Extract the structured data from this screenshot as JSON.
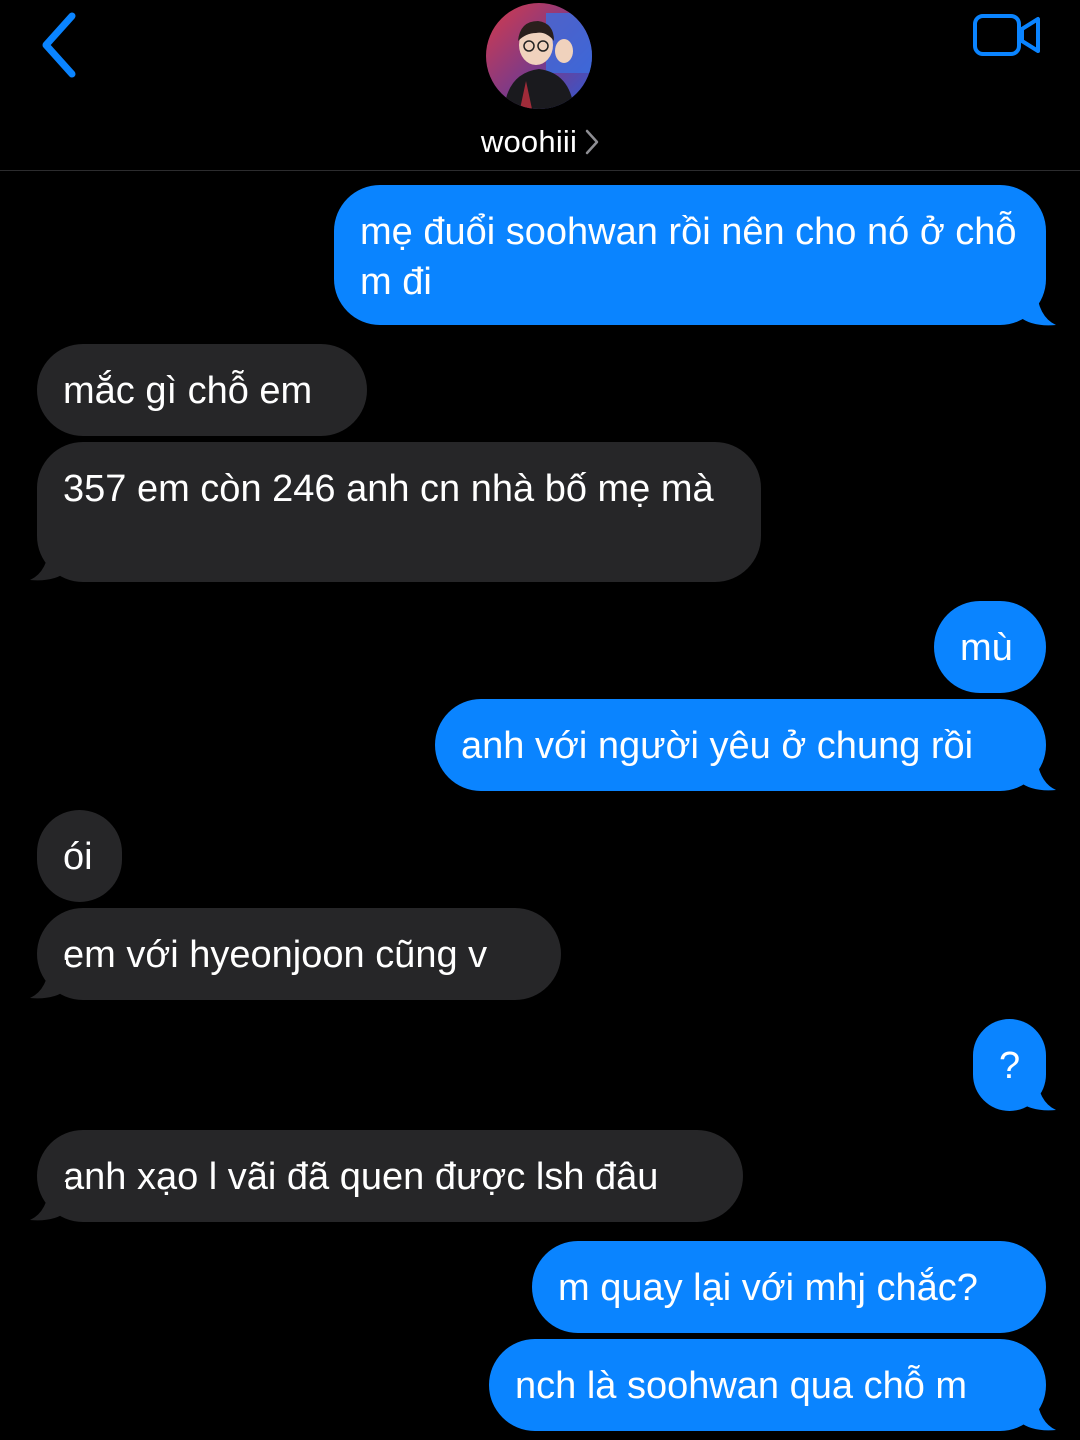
{
  "header": {
    "contact_name": "woohiii",
    "back_icon": "chevron-left-icon",
    "video_icon": "video-camera-icon",
    "accent_color": "#0a84ff"
  },
  "colors": {
    "sent_bubble": "#0a84ff",
    "received_bubble": "#262628",
    "background": "#000000"
  },
  "messages": [
    {
      "direction": "sent",
      "text": "mẹ đuổi soohwan rồi nên cho nó ở chỗ m đi"
    },
    {
      "direction": "received",
      "text": "mắc gì chỗ em"
    },
    {
      "direction": "received",
      "text": "357 em còn 246 anh cn nhà bố mẹ mà"
    },
    {
      "direction": "sent",
      "text": "mù"
    },
    {
      "direction": "sent",
      "text": "anh với người yêu ở chung rồi"
    },
    {
      "direction": "received",
      "text": "ói"
    },
    {
      "direction": "received",
      "text": "em với hyeonjoon cũng v"
    },
    {
      "direction": "sent",
      "text": "?"
    },
    {
      "direction": "received",
      "text": "anh xạo l vãi đã quen được lsh đâu"
    },
    {
      "direction": "sent",
      "text": "m quay lại với mhj chắc?"
    },
    {
      "direction": "sent",
      "text": "nch là soohwan qua chỗ m"
    }
  ]
}
